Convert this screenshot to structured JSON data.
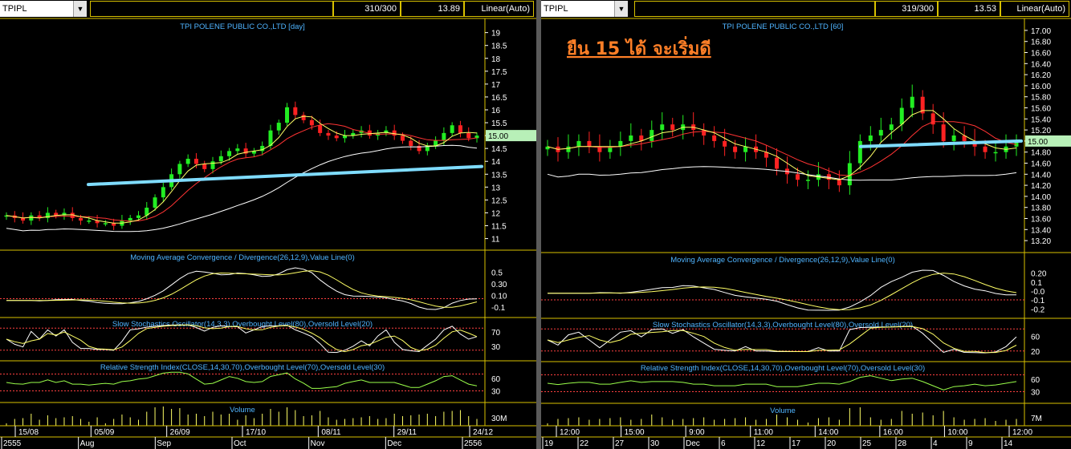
{
  "header_left": {
    "symbol": "TPIPL",
    "count": "310/300",
    "last": "13.89",
    "scale": "Linear(Auto)"
  },
  "header_right": {
    "symbol": "TPIPL",
    "count": "319/300",
    "last": "13.53",
    "scale": "Linear(Auto)"
  },
  "annotation": "ยืน 15 ได้ จะเริ่มดี",
  "colors": {
    "up": "#22ee22",
    "down": "#ff2222",
    "support": "#7fdcff",
    "ma_fast": "#ffff66",
    "ma_slow": "#ff3333",
    "ma_long": "#ffffff",
    "border": "#d8c100",
    "title": "#4fb4ff",
    "annotation": "#ff7f27"
  },
  "chart_data": [
    {
      "type": "line",
      "name": "TPI POLENE PUBLIC CO.,LTD [day]",
      "title": "TPI POLENE PUBLIC CO.,LTD [day]",
      "price_ticks": [
        "19",
        "18.5",
        "18",
        "17.5",
        "17",
        "16.5",
        "16",
        "15.5",
        "15",
        "14.5",
        "14",
        "13.5",
        "13",
        "12.5",
        "12",
        "11.5",
        "11"
      ],
      "ylim": [
        10.8,
        19.3
      ],
      "current_price_label": "15.00",
      "close": [
        11.9,
        11.8,
        11.7,
        11.9,
        11.8,
        12.0,
        11.9,
        12.0,
        11.8,
        11.7,
        11.7,
        11.6,
        11.6,
        11.5,
        11.7,
        11.8,
        11.9,
        12.2,
        12.6,
        13.0,
        13.5,
        13.9,
        14.1,
        13.9,
        13.7,
        14.0,
        14.2,
        14.4,
        14.5,
        14.3,
        14.4,
        14.6,
        15.2,
        15.5,
        16.1,
        15.8,
        15.6,
        15.4,
        15.1,
        15.0,
        14.9,
        15.0,
        15.1,
        15.2,
        15.0,
        15.1,
        15.2,
        15.0,
        14.8,
        14.6,
        14.4,
        14.6,
        14.8,
        15.1,
        15.4,
        15.1,
        14.9,
        15.0
      ],
      "support_line": [
        13.1,
        13.8
      ],
      "macd_title": "Moving Average Convergence / Divergence(26,12,9),Value Line(0)",
      "macd_ticks": [
        "0.5",
        "0.30",
        "0.10",
        "-0.1"
      ],
      "stoch_title": "Slow Stochastics Oscillator(14,3,3),Overbought Level(80),Oversold Level(20)",
      "stoch_ticks": [
        "70",
        "30"
      ],
      "rsi_title": "Relative Strength Index(CLOSE,14,30,70),Overbought Level(70),Oversold Level(30)",
      "rsi_ticks": [
        "60",
        "30"
      ],
      "volume_title": "Volume",
      "volume_ticks": [
        "30M"
      ],
      "x_top_labels": [
        "15/08",
        "05/09",
        "26/09",
        "17/10",
        "08/11",
        "29/11",
        "24/12"
      ],
      "x_bottom_labels": [
        "2555",
        "Aug",
        "Sep",
        "Oct",
        "Nov",
        "Dec",
        "2556"
      ]
    },
    {
      "type": "line",
      "name": "TPI POLENE PUBLIC CO.,LTD [60]",
      "title": "TPI POLENE PUBLIC CO.,LTD [60]",
      "price_ticks": [
        "17.00",
        "16.80",
        "16.60",
        "16.40",
        "16.20",
        "16.00",
        "15.80",
        "15.60",
        "15.40",
        "15.20",
        "15.00",
        "14.80",
        "14.60",
        "14.40",
        "14.20",
        "14.00",
        "13.80",
        "13.60",
        "13.40",
        "13.20"
      ],
      "ylim": [
        13.1,
        17.1
      ],
      "current_price_label": "15.00",
      "close": [
        14.9,
        14.8,
        14.9,
        15.0,
        14.9,
        14.8,
        14.9,
        15.0,
        15.1,
        15.0,
        15.2,
        15.3,
        15.2,
        15.3,
        15.2,
        15.1,
        15.0,
        14.9,
        14.8,
        14.9,
        14.8,
        14.7,
        14.5,
        14.4,
        14.3,
        14.3,
        14.4,
        14.3,
        14.2,
        14.6,
        15.0,
        15.1,
        15.2,
        15.3,
        15.6,
        15.8,
        15.5,
        15.3,
        15.0,
        15.1,
        15.0,
        14.9,
        14.8,
        14.8,
        14.9,
        15.0
      ],
      "support_line": [
        14.9,
        15.0
      ],
      "macd_title": "Moving Average Convergence / Divergence(26,12,9),Value Line(0)",
      "macd_ticks": [
        "0.20",
        "0.1",
        "-0.0",
        "-0.1",
        "-0.2"
      ],
      "stoch_title": "Slow Stochastics Oscillator(14,3,3),Overbought Level(80),Oversold Level(20)",
      "stoch_ticks": [
        "60",
        "20"
      ],
      "rsi_title": "Relative Strength Index(CLOSE,14,30,70),Overbought Level(70),Oversold Level(30)",
      "rsi_ticks": [
        "60",
        "30"
      ],
      "volume_title": "Volume",
      "volume_ticks": [
        "7M"
      ],
      "x_top_labels": [
        "12:00",
        "15:00",
        "9:00",
        "11:00",
        "14:00",
        "16:00",
        "10:00",
        "12:00"
      ],
      "x_bottom_labels": [
        "19",
        "22",
        "27",
        "30",
        "Dec",
        "6",
        "12",
        "17",
        "20",
        "25",
        "28",
        "4",
        "9",
        "14"
      ]
    }
  ]
}
